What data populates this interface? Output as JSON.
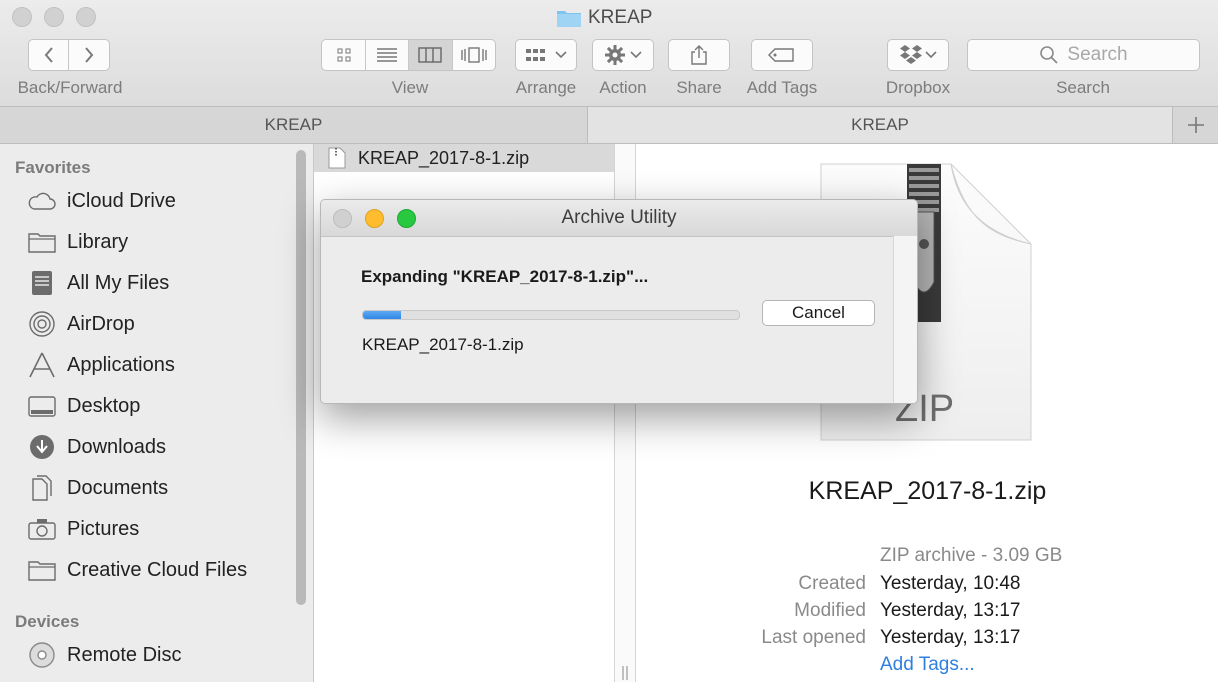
{
  "window": {
    "title": "KREAP"
  },
  "toolbar": {
    "back_forward_label": "Back/Forward",
    "view_label": "View",
    "arrange_label": "Arrange",
    "action_label": "Action",
    "share_label": "Share",
    "add_tags_label": "Add Tags",
    "dropbox_label": "Dropbox",
    "search_placeholder": "Search",
    "search_label": "Search"
  },
  "tabs": [
    "KREAP",
    "KREAP"
  ],
  "sidebar": {
    "favorites_header": "Favorites",
    "items": [
      {
        "label": "iCloud Drive",
        "icon": "cloud-icon"
      },
      {
        "label": "Library",
        "icon": "folder-icon"
      },
      {
        "label": "All My Files",
        "icon": "files-icon"
      },
      {
        "label": "AirDrop",
        "icon": "airdrop-icon"
      },
      {
        "label": "Applications",
        "icon": "applications-icon"
      },
      {
        "label": "Desktop",
        "icon": "desktop-icon"
      },
      {
        "label": "Downloads",
        "icon": "download-icon"
      },
      {
        "label": "Documents",
        "icon": "document-icon"
      },
      {
        "label": "Pictures",
        "icon": "camera-icon"
      },
      {
        "label": "Creative Cloud Files",
        "icon": "folder-icon"
      }
    ],
    "devices_header": "Devices",
    "devices": [
      {
        "label": "Remote Disc",
        "icon": "disc-icon"
      }
    ]
  },
  "column": {
    "file_name": "KREAP_2017-8-1.zip"
  },
  "dialog": {
    "title": "Archive Utility",
    "message": "Expanding \"KREAP_2017-8-1.zip\"...",
    "progress": 0.1,
    "cancel_label": "Cancel",
    "file_name": "KREAP_2017-8-1.zip"
  },
  "preview": {
    "icon_text": "ZIP",
    "file_name": "KREAP_2017-8-1.zip",
    "kind_size": "ZIP archive - 3.09 GB",
    "created_label": "Created",
    "created": "Yesterday, 10:48",
    "modified_label": "Modified",
    "modified": "Yesterday, 13:17",
    "last_opened_label": "Last opened",
    "last_opened": "Yesterday, 13:17",
    "add_tags_link": "Add Tags..."
  },
  "colors": {
    "accent": "#3b8ee8",
    "link": "#2f7fe0",
    "close": "#ff5f57",
    "minimize": "#febc2e",
    "zoom": "#28c840"
  }
}
